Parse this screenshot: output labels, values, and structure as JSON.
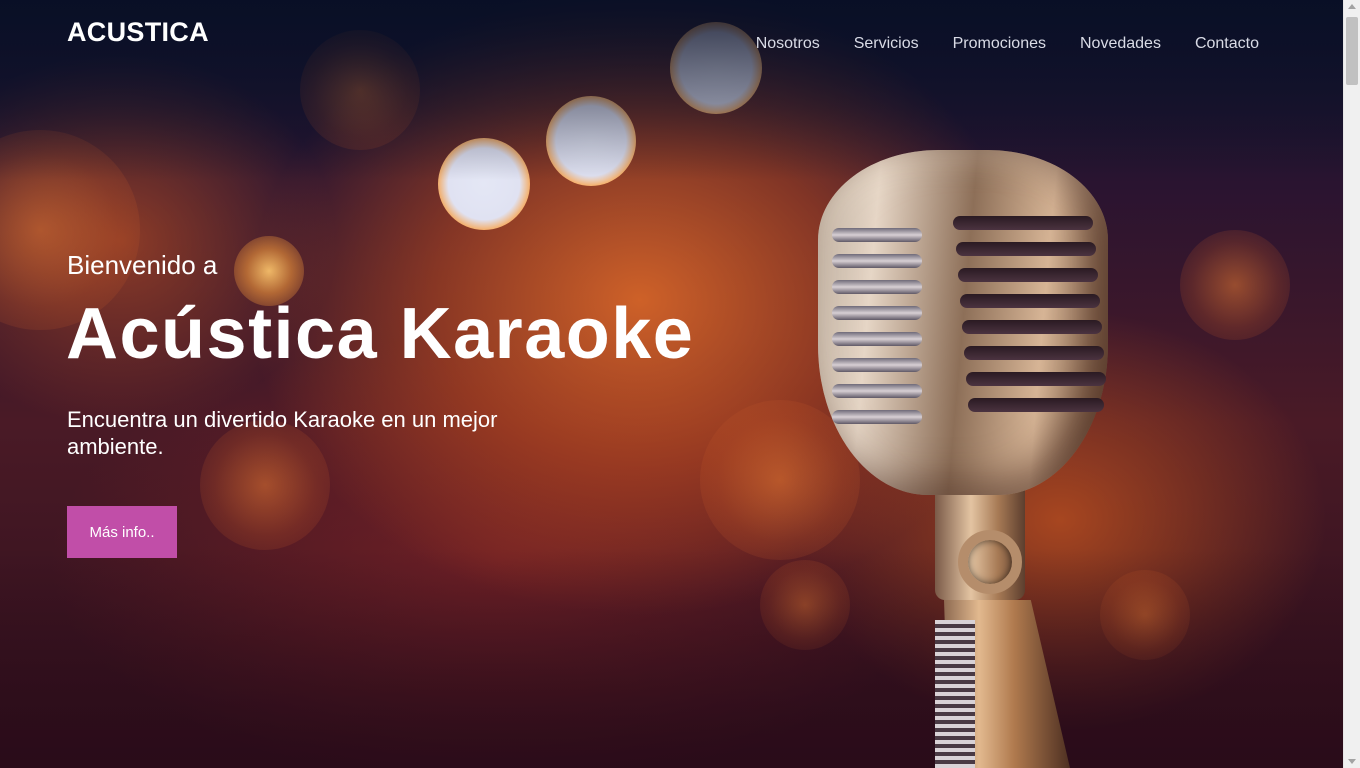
{
  "header": {
    "brand": "ACUSTICA",
    "nav": [
      {
        "label": "Nosotros"
      },
      {
        "label": "Servicios"
      },
      {
        "label": "Promociones"
      },
      {
        "label": "Novedades"
      },
      {
        "label": "Contacto"
      }
    ]
  },
  "hero": {
    "welcome": "Bienvenido a",
    "title": "Acústica Karaoke",
    "subtitle": "Encuentra un divertido Karaoke en un mejor ambiente.",
    "cta_label": "Más info..",
    "background_image": "microphone-bokeh-image"
  },
  "colors": {
    "cta_background": "#c14ea8",
    "text": "#ffffff",
    "nav_text": "#d9dbe6"
  }
}
